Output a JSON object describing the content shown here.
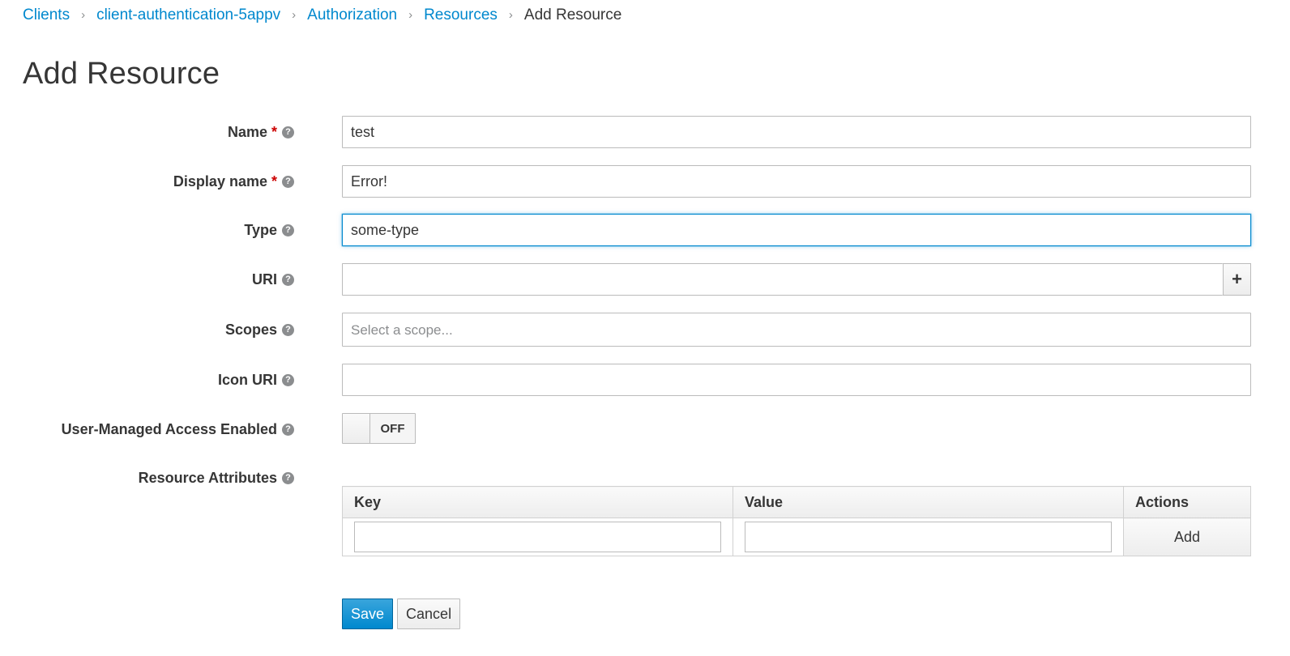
{
  "breadcrumb": {
    "items": [
      "Clients",
      "client-authentication-5appv",
      "Authorization",
      "Resources"
    ],
    "current": "Add Resource",
    "separator": "›"
  },
  "page": {
    "title": "Add Resource"
  },
  "form": {
    "name": {
      "label": "Name",
      "required": "*",
      "value": "test"
    },
    "display_name": {
      "label": "Display name",
      "required": "*",
      "value": "Error!"
    },
    "type": {
      "label": "Type",
      "value": "some-type"
    },
    "uri": {
      "label": "URI",
      "value": "",
      "add_button": "+"
    },
    "scopes": {
      "label": "Scopes",
      "placeholder": "Select a scope..."
    },
    "icon_uri": {
      "label": "Icon URI",
      "value": ""
    },
    "user_managed": {
      "label": "User-Managed Access Enabled",
      "state": "OFF"
    },
    "attributes": {
      "label": "Resource Attributes",
      "columns": [
        "Key",
        "Value",
        "Actions"
      ],
      "add_label": "Add"
    },
    "help_glyph": "?"
  },
  "actions": {
    "save": "Save",
    "cancel": "Cancel"
  },
  "colors": {
    "link": "#0088ce",
    "primary": "#0088ce",
    "required": "#cc0000"
  }
}
